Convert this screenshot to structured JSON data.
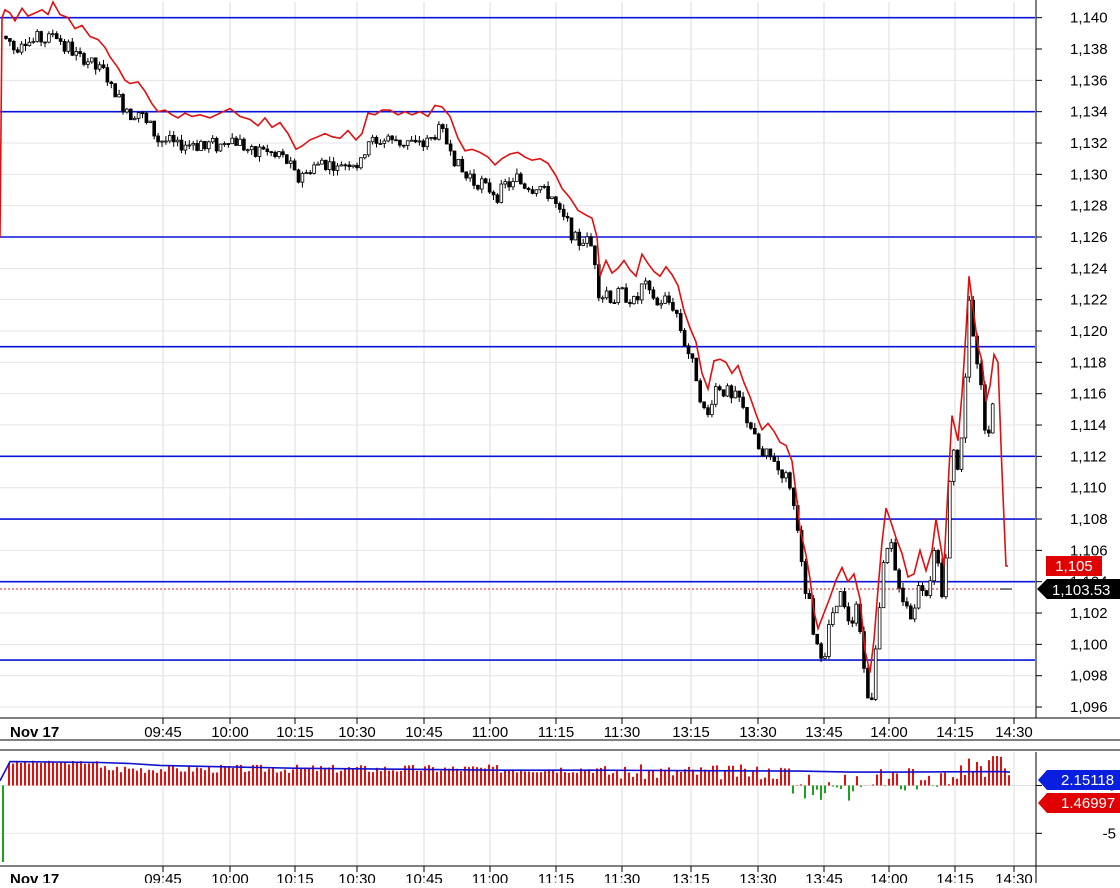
{
  "chart_data": [
    {
      "type": "candlestick",
      "panel": "price",
      "date_label": "Nov 17",
      "x_tick_labels": [
        "09:45",
        "10:00",
        "10:15",
        "10:30",
        "10:45",
        "11:00",
        "11:15",
        "11:30",
        "13:15",
        "13:30",
        "13:45",
        "14:00",
        "14:15",
        "14:30"
      ],
      "y_tick_labels": [
        "1,140",
        "1,138",
        "1,136",
        "1,134",
        "1,132",
        "1,130",
        "1,128",
        "1,126",
        "1,124",
        "1,122",
        "1,120",
        "1,118",
        "1,116",
        "1,114",
        "1,112",
        "1,110",
        "1,108",
        "1,106",
        "1,104",
        "1,102",
        "1,100",
        "1,098",
        "1,096"
      ],
      "ylim": [
        1095.3,
        1141.0
      ],
      "grid": true,
      "horizontal_levels": [
        1140.0,
        1134.0,
        1126.0,
        1119.0,
        1112.0,
        1108.0,
        1104.0,
        1099.0
      ],
      "reference_line": {
        "value": 1103.53,
        "style": "dotted",
        "color": "#d01818"
      },
      "price_labels": [
        {
          "text": "1,105",
          "value": 1105.0,
          "bg": "#e00000",
          "fg": "#ffffff"
        },
        {
          "text": "1,103.53",
          "value": 1103.53,
          "bg": "#000000",
          "fg": "#ffffff"
        }
      ],
      "red_line": {
        "color": "#e01010",
        "points": [
          [
            0,
            1126
          ],
          [
            2,
            1140
          ],
          [
            5,
            1140.5
          ],
          [
            10,
            1140.3
          ],
          [
            15,
            1139.8
          ],
          [
            22,
            1140.6
          ],
          [
            28,
            1140.1
          ],
          [
            35,
            1140.3
          ],
          [
            42,
            1140.5
          ],
          [
            48,
            1140.2
          ],
          [
            53,
            1141.0
          ],
          [
            60,
            1140.2
          ],
          [
            68,
            1140.0
          ],
          [
            75,
            1139.3
          ],
          [
            82,
            1139.5
          ],
          [
            90,
            1138.8
          ],
          [
            98,
            1138.6
          ],
          [
            105,
            1138.1
          ],
          [
            110,
            1137.5
          ],
          [
            118,
            1136.8
          ],
          [
            125,
            1136.0
          ],
          [
            130,
            1135.8
          ],
          [
            138,
            1135.9
          ],
          [
            145,
            1135.3
          ],
          [
            152,
            1134.5
          ],
          [
            158,
            1134.0
          ],
          [
            165,
            1134.1
          ],
          [
            172,
            1133.8
          ],
          [
            178,
            1133.6
          ],
          [
            185,
            1133.9
          ],
          [
            192,
            1133.7
          ],
          [
            200,
            1133.8
          ],
          [
            210,
            1133.6
          ],
          [
            220,
            1133.9
          ],
          [
            230,
            1134.2
          ],
          [
            240,
            1133.7
          ],
          [
            250,
            1133.5
          ],
          [
            258,
            1133.1
          ],
          [
            265,
            1133.6
          ],
          [
            272,
            1133.0
          ],
          [
            280,
            1133.3
          ],
          [
            288,
            1132.6
          ],
          [
            296,
            1131.6
          ],
          [
            302,
            1131.8
          ],
          [
            310,
            1132.2
          ],
          [
            318,
            1132.4
          ],
          [
            325,
            1132.6
          ],
          [
            332,
            1132.4
          ],
          [
            340,
            1132.3
          ],
          [
            348,
            1132.8
          ],
          [
            356,
            1132.2
          ],
          [
            362,
            1132.6
          ],
          [
            368,
            1133.9
          ],
          [
            375,
            1133.8
          ],
          [
            382,
            1134.1
          ],
          [
            390,
            1134.1
          ],
          [
            398,
            1133.8
          ],
          [
            405,
            1134.0
          ],
          [
            412,
            1133.8
          ],
          [
            420,
            1134.0
          ],
          [
            428,
            1133.7
          ],
          [
            435,
            1134.4
          ],
          [
            442,
            1134.3
          ],
          [
            450,
            1133.7
          ],
          [
            458,
            1132.3
          ],
          [
            465,
            1131.5
          ],
          [
            472,
            1131.6
          ],
          [
            480,
            1131.4
          ],
          [
            488,
            1131.1
          ],
          [
            495,
            1130.6
          ],
          [
            502,
            1131.0
          ],
          [
            510,
            1131.3
          ],
          [
            518,
            1131.4
          ],
          [
            525,
            1131.1
          ],
          [
            532,
            1130.9
          ],
          [
            540,
            1131.0
          ],
          [
            548,
            1130.7
          ],
          [
            556,
            1129.9
          ],
          [
            562,
            1129.1
          ],
          [
            570,
            1128.5
          ],
          [
            578,
            1127.7
          ],
          [
            586,
            1127.4
          ],
          [
            592,
            1127.2
          ],
          [
            597,
            1126.0
          ],
          [
            600,
            1123.5
          ],
          [
            606,
            1124.5
          ],
          [
            612,
            1123.7
          ],
          [
            618,
            1124.0
          ],
          [
            624,
            1124.5
          ],
          [
            630,
            1123.9
          ],
          [
            636,
            1123.5
          ],
          [
            642,
            1124.9
          ],
          [
            648,
            1124.3
          ],
          [
            654,
            1123.8
          ],
          [
            660,
            1123.5
          ],
          [
            666,
            1124.1
          ],
          [
            672,
            1123.6
          ],
          [
            678,
            1122.9
          ],
          [
            684,
            1121.3
          ],
          [
            690,
            1120.2
          ],
          [
            696,
            1119.3
          ],
          [
            702,
            1117.3
          ],
          [
            708,
            1116.3
          ],
          [
            714,
            1118.1
          ],
          [
            720,
            1118.2
          ],
          [
            726,
            1118.0
          ],
          [
            732,
            1117.3
          ],
          [
            738,
            1117.8
          ],
          [
            744,
            1116.7
          ],
          [
            750,
            1115.8
          ],
          [
            756,
            1114.7
          ],
          [
            762,
            1113.7
          ],
          [
            768,
            1114.1
          ],
          [
            774,
            1113.6
          ],
          [
            780,
            1112.9
          ],
          [
            786,
            1112.7
          ],
          [
            792,
            1111.7
          ],
          [
            796,
            1109.7
          ],
          [
            800,
            1107.4
          ],
          [
            806,
            1105.7
          ],
          [
            810,
            1104.2
          ],
          [
            814,
            1102.1
          ],
          [
            818,
            1101.0
          ],
          [
            824,
            1102.0
          ],
          [
            830,
            1103.0
          ],
          [
            836,
            1104.1
          ],
          [
            842,
            1104.9
          ],
          [
            848,
            1104.0
          ],
          [
            854,
            1104.5
          ],
          [
            860,
            1102.9
          ],
          [
            865,
            1099.6
          ],
          [
            870,
            1098.2
          ],
          [
            874,
            1100.3
          ],
          [
            878,
            1103.5
          ],
          [
            882,
            1106.5
          ],
          [
            886,
            1108.7
          ],
          [
            890,
            1108.0
          ],
          [
            896,
            1106.8
          ],
          [
            902,
            1105.8
          ],
          [
            908,
            1104.3
          ],
          [
            914,
            1104.5
          ],
          [
            920,
            1106.0
          ],
          [
            926,
            1104.7
          ],
          [
            932,
            1106.0
          ],
          [
            936,
            1108.0
          ],
          [
            940,
            1106.5
          ],
          [
            944,
            1105.0
          ],
          [
            948,
            1110.0
          ],
          [
            952,
            1114.6
          ],
          [
            958,
            1113.0
          ],
          [
            962,
            1116.0
          ],
          [
            966,
            1120.0
          ],
          [
            969,
            1123.5
          ],
          [
            974,
            1121.0
          ],
          [
            978,
            1119.0
          ],
          [
            982,
            1118.1
          ],
          [
            986,
            1115.5
          ],
          [
            990,
            1116.5
          ],
          [
            994,
            1118.5
          ],
          [
            998,
            1118.0
          ],
          [
            1002,
            1111.0
          ],
          [
            1006,
            1105.0
          ],
          [
            1008,
            1105.0
          ]
        ]
      }
    },
    {
      "type": "bar",
      "panel": "oscillator",
      "date_label": "Nov 17",
      "x_tick_labels": [
        "09:45",
        "10:00",
        "10:15",
        "10:30",
        "10:45",
        "11:00",
        "11:15",
        "11:30",
        "13:15",
        "13:30",
        "13:45",
        "14:00",
        "14:15",
        "14:30"
      ],
      "y_tick_labels": [
        "0",
        "-5"
      ],
      "ylim": [
        -8.0,
        3.5
      ],
      "blue_line": {
        "color": "#1010d0",
        "points": [
          [
            0,
            0.5
          ],
          [
            10,
            2.5
          ],
          [
            100,
            2.4
          ],
          [
            130,
            2.3
          ],
          [
            160,
            2.1
          ],
          [
            200,
            2.0
          ],
          [
            300,
            1.8
          ],
          [
            400,
            1.7
          ],
          [
            500,
            1.6
          ],
          [
            600,
            1.6
          ],
          [
            700,
            1.55
          ],
          [
            800,
            1.5
          ],
          [
            850,
            1.4
          ],
          [
            900,
            1.4
          ],
          [
            1000,
            1.45
          ],
          [
            1010,
            1.4
          ]
        ]
      },
      "value_labels": [
        {
          "text": "2.15118",
          "value": 2.15118,
          "bg": "#0a1ee0",
          "fg": "#ffffff"
        },
        {
          "text": "1.46997",
          "value": 1.46997,
          "bg": "#e00000",
          "fg": "#ffffff"
        }
      ]
    }
  ]
}
